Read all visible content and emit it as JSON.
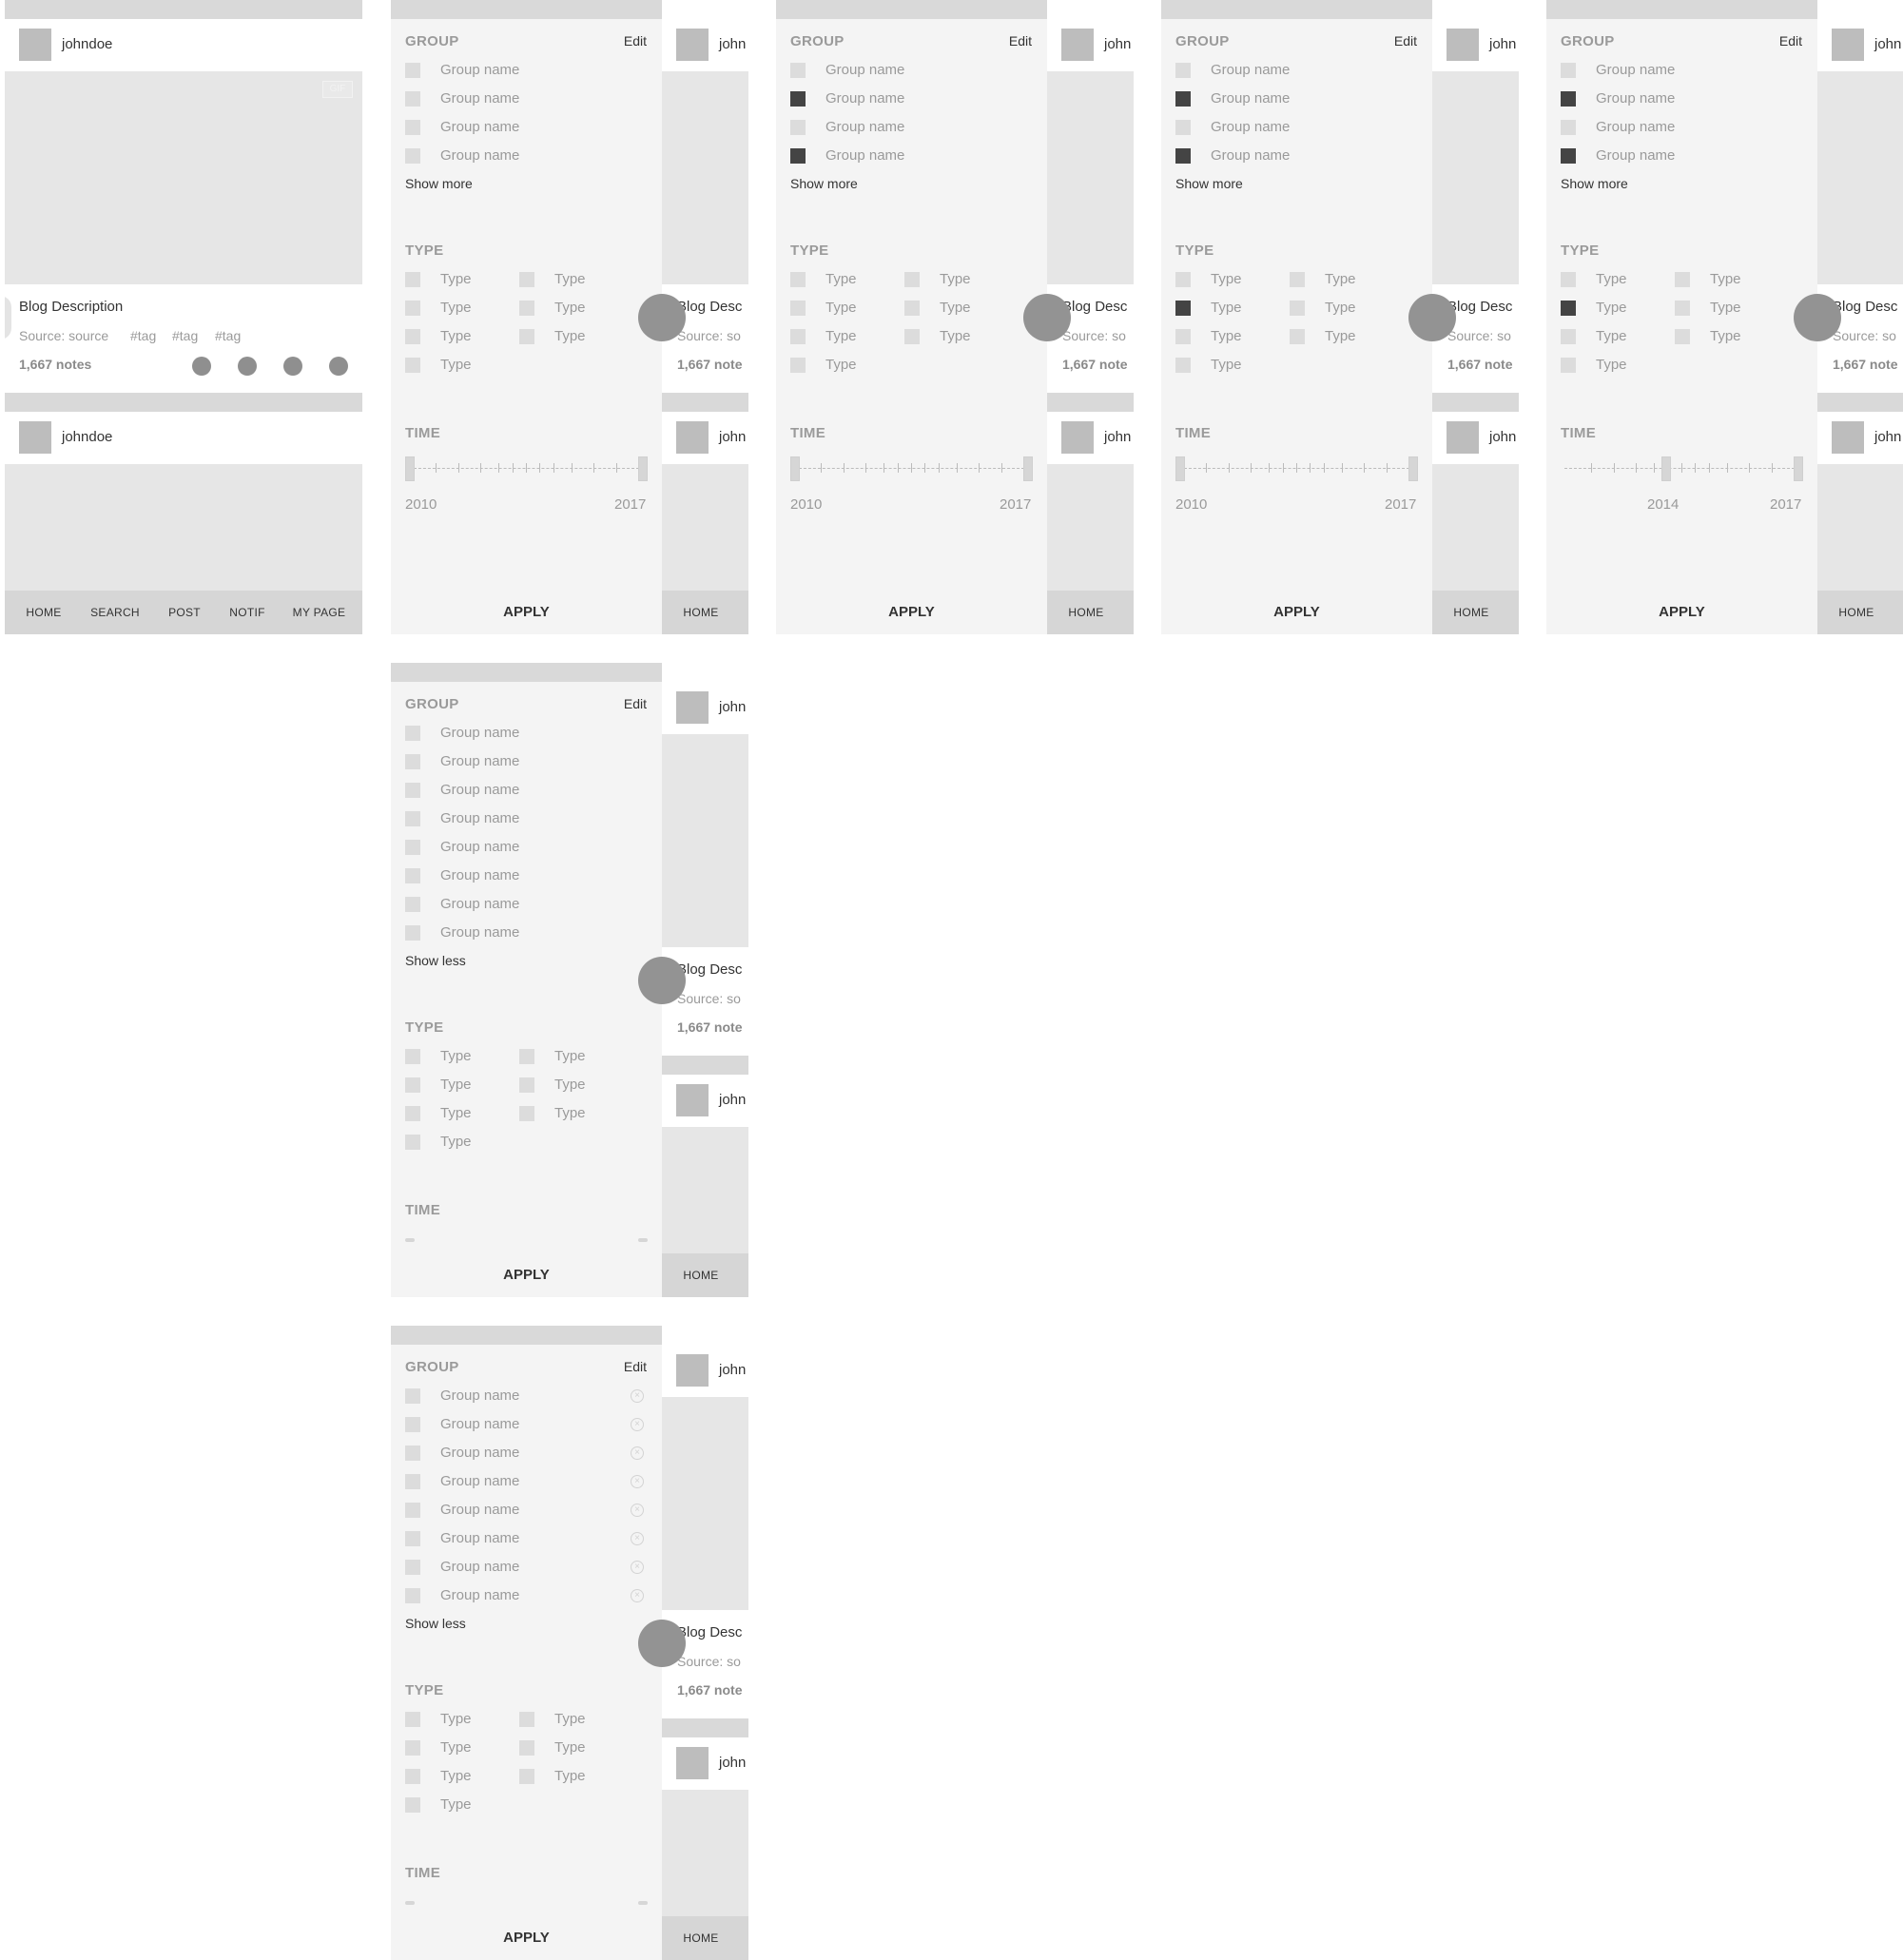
{
  "feed": {
    "username": "johndoe",
    "username_short": "john",
    "gif_badge": "GIF",
    "blog_description": "Blog Description",
    "blog_description_short": "Blog Desc",
    "source": "Source: source",
    "source_short": "Source: so",
    "tags": [
      "#tag",
      "#tag",
      "#tag"
    ],
    "notes": "1,667 notes",
    "notes_short": "1,667 note"
  },
  "tabbar": {
    "home": "HOME",
    "search": "SEARCH",
    "post": "POST",
    "notif": "NOTIF",
    "my_page": "MY PAGE"
  },
  "filter": {
    "group_title": "GROUP",
    "edit_label": "Edit",
    "group_item": "Group name",
    "show_more": "Show more",
    "show_less": "Show less",
    "type_title": "TYPE",
    "type_item": "Type",
    "time_title": "TIME",
    "apply_label": "APPLY",
    "year_start": "2010",
    "year_mid": "2014",
    "year_end": "2017"
  },
  "states": [
    {
      "screen": "filter-1",
      "groups_checked": [],
      "types_checked": [],
      "time_range": [
        "2010",
        "2017"
      ]
    },
    {
      "screen": "filter-2",
      "groups_checked": [
        1,
        3
      ],
      "types_checked": [],
      "time_range": [
        "2010",
        "2017"
      ]
    },
    {
      "screen": "filter-3",
      "groups_checked": [
        1,
        3
      ],
      "types_checked": [
        1
      ],
      "time_range": [
        "2010",
        "2017"
      ]
    },
    {
      "screen": "filter-4",
      "groups_checked": [
        1,
        3
      ],
      "types_checked": [
        1
      ],
      "time_range": [
        "2014",
        "2017"
      ]
    },
    {
      "screen": "filter-expanded",
      "groups_checked": [],
      "types_checked": []
    },
    {
      "screen": "filter-edit",
      "groups_checked": [],
      "types_checked": []
    }
  ],
  "icons": [
    "action-icon",
    "floating-action-button",
    "remove-group-icon"
  ]
}
